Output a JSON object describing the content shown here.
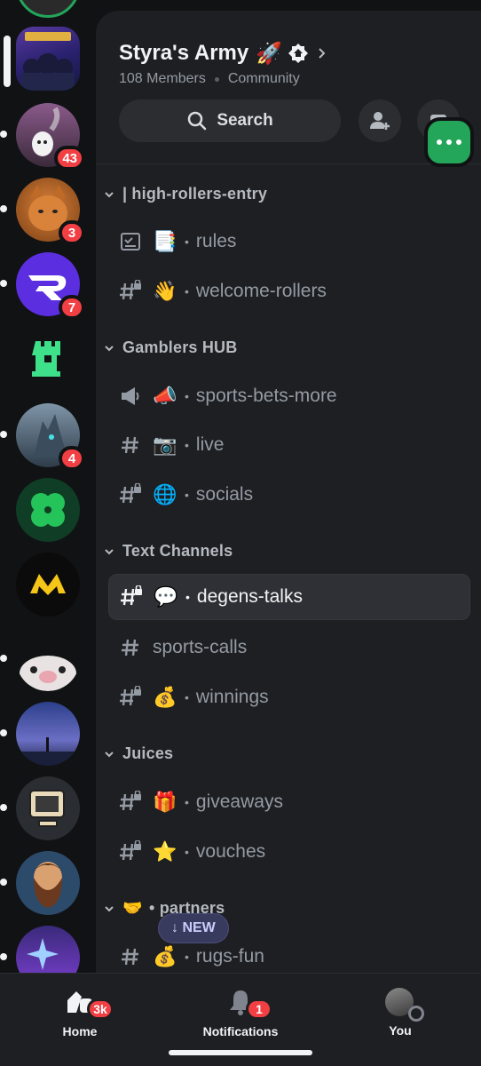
{
  "server": {
    "name": "Styra's Army",
    "title_emoji": "🚀",
    "member_count": "108 Members",
    "type": "Community"
  },
  "search": {
    "label": "Search"
  },
  "rail_badges": [
    "43",
    "3",
    "7",
    "4"
  ],
  "categories": [
    {
      "label": "| high-rollers-entry"
    },
    {
      "label": "Gamblers HUB"
    },
    {
      "label": "Text Channels"
    },
    {
      "label": "Juices"
    },
    {
      "label": "• partners",
      "emoji": "🤝"
    }
  ],
  "channels": [
    {
      "emoji": "📑",
      "name": "rules",
      "icon": "rules-icon"
    },
    {
      "emoji": "👋",
      "name": "welcome-rollers",
      "icon": "locked-hash-icon"
    },
    {
      "emoji": "📣",
      "name": "sports-bets-more",
      "icon": "announcement-icon"
    },
    {
      "emoji": "📷",
      "name": "live",
      "icon": "hash-icon"
    },
    {
      "emoji": "🌐",
      "name": "socials",
      "icon": "locked-hash-icon"
    },
    {
      "emoji": "💬",
      "name": "degens-talks",
      "icon": "locked-hash-icon"
    },
    {
      "emoji": "",
      "name": "sports-calls",
      "icon": "hash-icon"
    },
    {
      "emoji": "💰",
      "name": "winnings",
      "icon": "locked-hash-icon"
    },
    {
      "emoji": "🎁",
      "name": "giveaways",
      "icon": "locked-hash-icon"
    },
    {
      "emoji": "⭐",
      "name": "vouches",
      "icon": "locked-hash-icon"
    },
    {
      "emoji": "💰",
      "name": "rugs-fun",
      "icon": "hash-icon"
    }
  ],
  "new_pill": {
    "label": "↓ NEW"
  },
  "nav": {
    "home": {
      "label": "Home",
      "badge": "3k"
    },
    "notifications": {
      "label": "Notifications",
      "badge": "1"
    },
    "you": {
      "label": "You"
    }
  },
  "colors": {
    "accent_green": "#23a55a",
    "badge_red": "#f23f43",
    "new_pill": "#393b5e"
  }
}
